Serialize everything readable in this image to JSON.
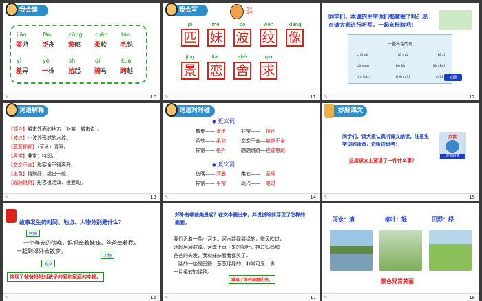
{
  "slides": [
    {
      "num": "10",
      "header": "我会读",
      "pinyin": [
        "jiāo",
        "fàn",
        "cōng",
        "ruǎn",
        "tǎn",
        "yì",
        "yè",
        "shí",
        "qí",
        "kuà"
      ],
      "words": [
        {
          "red": "郊",
          "rest": "游"
        },
        {
          "red": "泛",
          "rest": "舟"
        },
        {
          "red": "葱",
          "rest": "郁"
        },
        {
          "red": "柔",
          "rest": "软"
        },
        {
          "red": "毛",
          "rest": "毯"
        },
        {
          "red": "差",
          "rest": "异"
        },
        {
          "red": "一",
          "rest": "株"
        },
        {
          "red": "拾",
          "rest": "起"
        },
        {
          "red": "骑",
          "rest": "马"
        },
        {
          "red": "跨",
          "rest": "越"
        }
      ]
    },
    {
      "num": "11",
      "header": "我会写",
      "badge": "五步写字",
      "row1_pinyin": [
        "pǐ",
        "mèi",
        "bō",
        "wén",
        "xiàng"
      ],
      "row1_chars": [
        "匹",
        "妹",
        "波",
        "纹",
        "像"
      ],
      "row2_pinyin": [
        "jǐng",
        "liàn",
        "shě",
        "qiú"
      ],
      "row2_chars": [
        "景",
        "恋",
        "舍",
        "求"
      ]
    },
    {
      "num": "12",
      "title": "同学们，本课的生字你们都掌握了吗？现在请大家进行听写，一起来检验吧！",
      "card_title": "一些出色的马",
      "card_words": [
        "chū sè",
        "fú mó",
        "bì zī"
      ],
      "card_words2": [
        "bō wén",
        "bō lán",
        "tān kāi"
      ],
      "card_words3": [
        "lán tiān",
        "shèn zhì",
        "yì bǎi"
      ],
      "back_label": "返回"
    },
    {
      "num": "13",
      "header": "词语解释",
      "items": [
        {
          "term": "【郊外】",
          "def": "城市外面的地方（对某一城市说）。"
        },
        {
          "term": "【波纹】",
          "def": "小波浪形成的水纹。"
        },
        {
          "term": "【葱葱郁郁】",
          "def": "（草木）青翠。"
        },
        {
          "term": "【异常】",
          "def": "非常；特别。"
        },
        {
          "term": "【恋恋不舍】",
          "def": "形容舍不得离开。"
        },
        {
          "term": "【出色】",
          "def": "特别好；超出一般。"
        },
        {
          "term": "【蹦蹦跳跳】",
          "def": "形容很活泼、很爱动。"
        }
      ]
    },
    {
      "num": "14",
      "header": "词语对对碰",
      "syn_title": "近义词",
      "ant_title": "反义词",
      "syn": [
        [
          "散步——",
          "漫步",
          "非常——",
          "特别"
        ],
        [
          "柔软——",
          "柔和",
          "恋恋不舍——",
          "依依不舍"
        ],
        [
          "异常——",
          "格外",
          "蹦蹦跳跳——",
          "连蹦带跳"
        ]
      ],
      "ant": [
        [
          "伤晚——",
          "清晨",
          "柔软——",
          "坚硬"
        ],
        [
          "异常——",
          "平常",
          "高兴——",
          "难过"
        ]
      ]
    },
    {
      "num": "15",
      "header": "妙解课文",
      "text": "同学们，请大家认真听课文朗读，注意生字词的读音，边听边思考：",
      "question": "这篇课文主要讲了一件什么事？",
      "btn": "点我",
      "audio_label": "课文朗读"
    },
    {
      "num": "16",
      "question": "故事发生的时间、地点、人物分别是什么？",
      "tag_time": "时间",
      "tag_place": "地点",
      "tag_person": "人物",
      "lines": [
        "一个春天的傍晚，妈妈牵着妹妹，爸爸牵着我，",
        "一起到郊外去散步。"
      ],
      "summary": "体现了爸爸妈妈对孩子的爱和家庭的幸福。"
    },
    {
      "num": "17",
      "question": "郊外有哪些美景呢？在文中圈出来，并说说眼前浮现了怎样的画面。",
      "lines": [
        "我们沿着一条小河走。河水碧绿碧绿的，微风吹过，",
        "泛起层层波纹。河岸上垂下来的柳叶，拂过妈妈和",
        "爸爸的头发，我和妹妹看着都笑了。",
        "　路的一边是田野，葱葱绿绿的，非常可爱，像",
        "一片柔软的绿毯。"
      ],
      "summary": "爱出了郊外田野的美。"
    },
    {
      "num": "18",
      "labels": [
        "河水：清",
        "柳叶：轻",
        "田野：绿"
      ],
      "caption": "景色异常美丽"
    }
  ]
}
